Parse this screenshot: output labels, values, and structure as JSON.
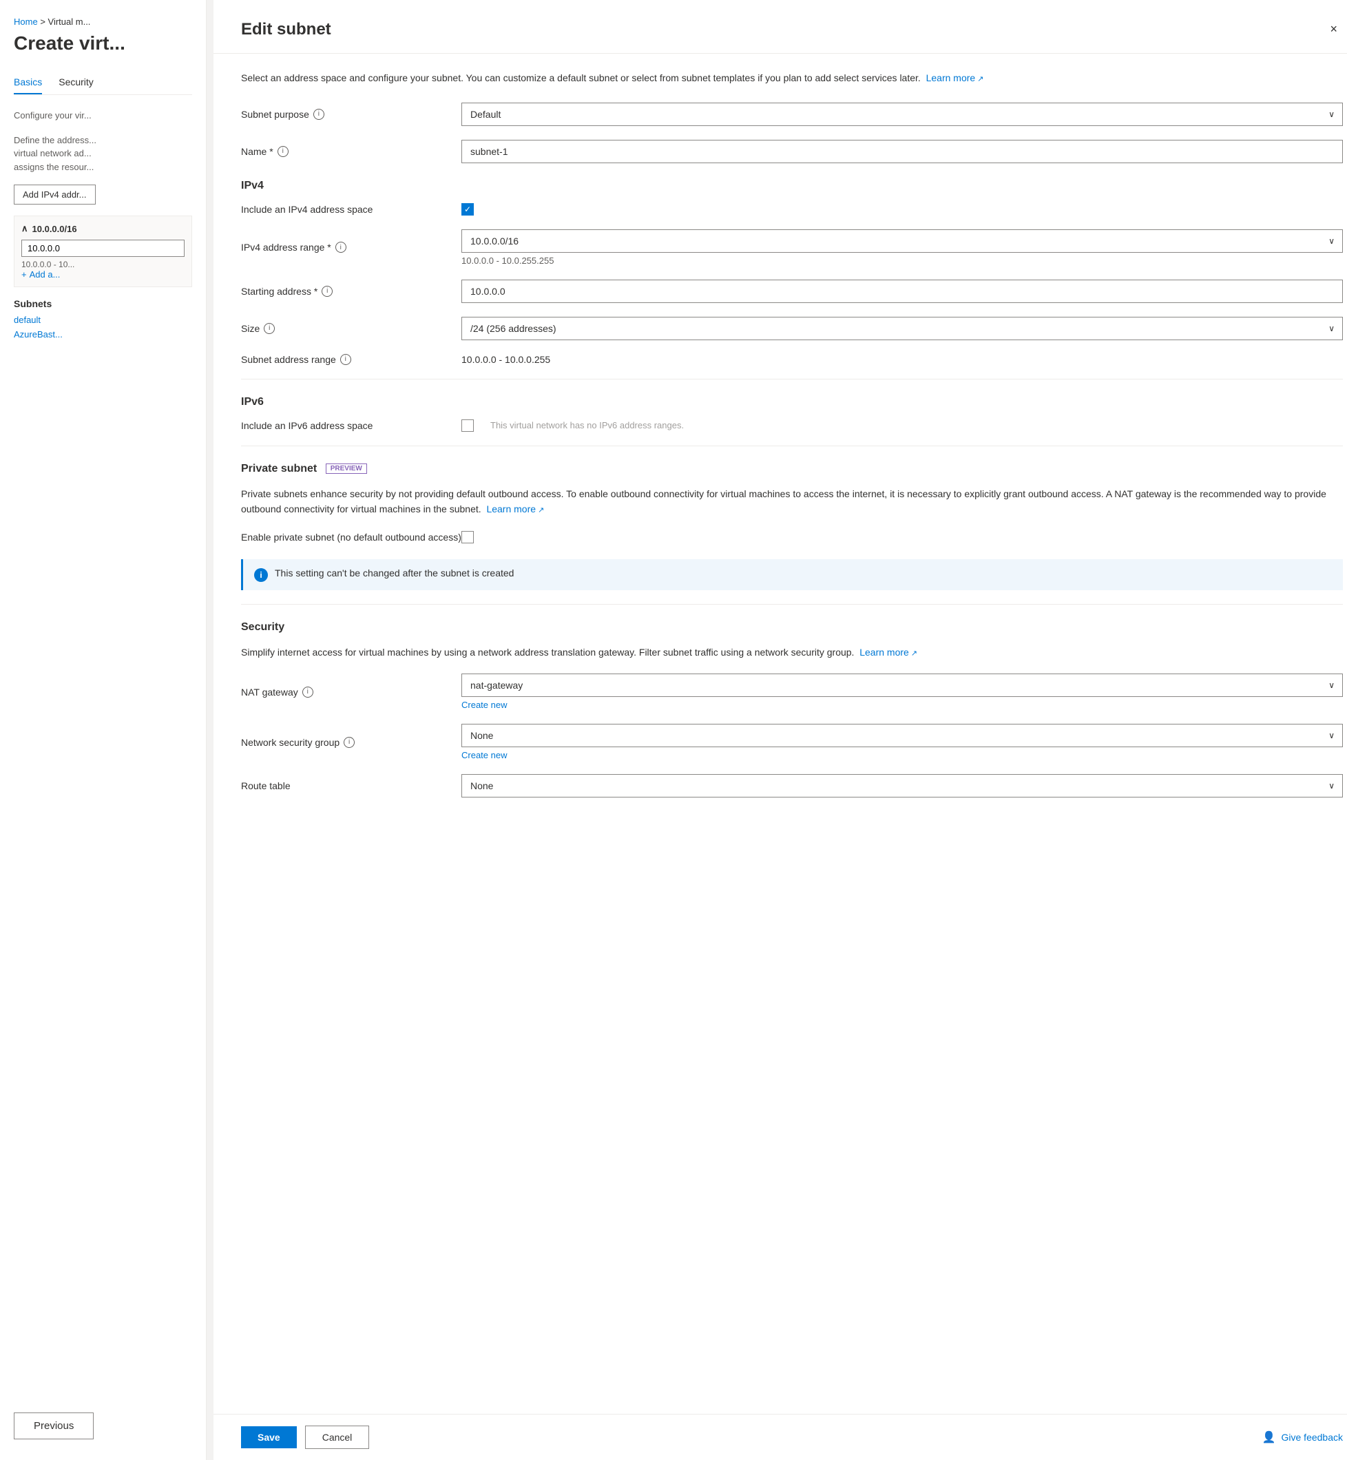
{
  "breadcrumb": {
    "home": "Home",
    "separator": ">",
    "current": "Virtual m..."
  },
  "page": {
    "title": "Create virt...",
    "tabs": [
      "Basics",
      "Security",
      ""
    ]
  },
  "left_panel": {
    "configure_label": "Configure your vir...",
    "define_label": "Define the address...",
    "virtual_network_addr": "virtual network ad...",
    "assigns_label": "assigns the resour...",
    "add_btn": "Add IPv4 addr...",
    "ip_block": "10.0.0.0/16",
    "ip_input": "10.0.0.0",
    "ip_sub": "10.0.0.0 - 10...",
    "add_link": "Add a...",
    "subnets_label": "Subnets",
    "subnet1": "default",
    "subnet2": "AzureBast..."
  },
  "panel": {
    "title": "Edit subnet",
    "intro": "Select an address space and configure your subnet. You can customize a default subnet or select from subnet templates if you plan to add select services later.",
    "learn_more": "Learn more",
    "close_label": "×",
    "subnet_purpose_label": "Subnet purpose",
    "subnet_purpose_info": "i",
    "subnet_purpose_value": "Default",
    "name_label": "Name *",
    "name_info": "i",
    "name_value": "subnet-1",
    "ipv4_heading": "IPv4",
    "include_ipv4_label": "Include an IPv4 address space",
    "ipv4_range_label": "IPv4 address range *",
    "ipv4_range_info": "i",
    "ipv4_range_value": "10.0.0.0/16",
    "ipv4_range_sub": "10.0.0.0 - 10.0.255.255",
    "starting_address_label": "Starting address *",
    "starting_address_info": "i",
    "starting_address_value": "10.0.0.0",
    "size_label": "Size",
    "size_info": "i",
    "size_value": "/24 (256 addresses)",
    "subnet_range_label": "Subnet address range",
    "subnet_range_info": "i",
    "subnet_range_value": "10.0.0.0 - 10.0.0.255",
    "ipv6_heading": "IPv6",
    "include_ipv6_label": "Include an IPv6 address space",
    "ipv6_note": "This virtual network has no IPv6 address ranges.",
    "private_subnet_heading": "Private subnet",
    "preview_badge": "PREVIEW",
    "private_desc": "Private subnets enhance security by not providing default outbound access. To enable outbound connectivity for virtual machines to access the internet, it is necessary to explicitly grant outbound access. A NAT gateway is the recommended way to provide outbound connectivity for virtual machines in the subnet.",
    "private_learn_more": "Learn more",
    "enable_private_label": "Enable private subnet (no default outbound access)",
    "private_info_note": "This setting can't be changed after the subnet is created",
    "security_heading": "Security",
    "security_desc": "Simplify internet access for virtual machines by using a network address translation gateway. Filter subnet traffic using a network security group.",
    "security_learn_more": "Learn more",
    "nat_gateway_label": "NAT gateway",
    "nat_gateway_info": "i",
    "nat_gateway_value": "nat-gateway",
    "nat_create_new": "Create new",
    "nsg_label": "Network security group",
    "nsg_info": "i",
    "nsg_value": "None",
    "nsg_create_new": "Create new",
    "route_table_label": "Route table",
    "route_table_value": "None",
    "save_btn": "Save",
    "cancel_btn": "Cancel",
    "give_feedback": "Give feedback",
    "previous_btn": "Previous"
  }
}
